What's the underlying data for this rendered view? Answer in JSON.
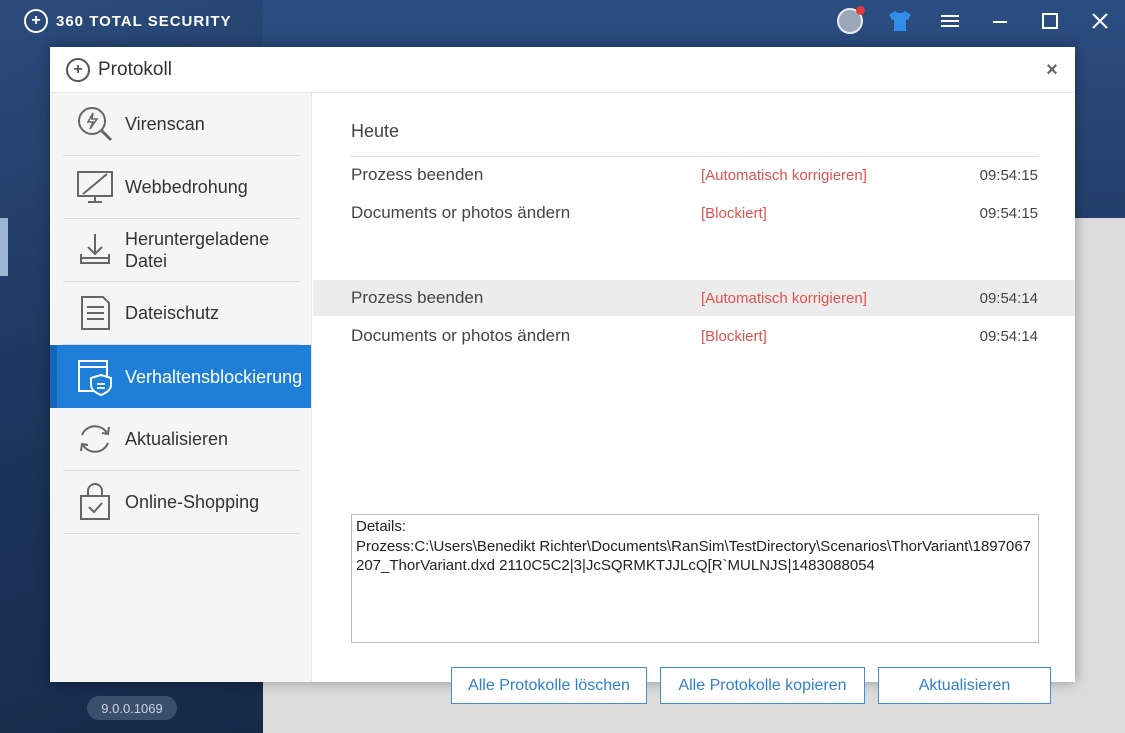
{
  "app": {
    "brand": "360 TOTAL SECURITY",
    "version": "9.0.0.1069"
  },
  "titlebar": {
    "icons": [
      "avatar-icon",
      "skin-shirt-icon",
      "menu-icon",
      "minimize-icon",
      "maximize-icon",
      "close-icon"
    ]
  },
  "dialog": {
    "title": "Protokoll",
    "close_symbol": "×",
    "nav": [
      {
        "label": "Virenscan",
        "icon": "virus-scan-icon",
        "active": false
      },
      {
        "label": "Webbedrohung",
        "icon": "web-threat-icon",
        "active": false
      },
      {
        "label": "Heruntergeladene Datei",
        "icon": "download-icon",
        "active": false
      },
      {
        "label": "Dateischutz",
        "icon": "file-protection-icon",
        "active": false
      },
      {
        "label": "Verhaltensblockierung",
        "icon": "behavior-block-icon",
        "active": true
      },
      {
        "label": "Aktualisieren",
        "icon": "update-icon",
        "active": false
      },
      {
        "label": "Online-Shopping",
        "icon": "shopping-bag-icon",
        "active": false
      }
    ],
    "section_title": "Heute",
    "logs": [
      {
        "name": "Prozess beenden",
        "status": "[Automatisch korrigieren]",
        "time": "09:54:15",
        "highlighted": false
      },
      {
        "name": "Documents or photos ändern",
        "status": "[Blockiert]",
        "time": "09:54:15",
        "highlighted": false
      },
      {
        "name": "Prozess beenden",
        "status": "[Automatisch korrigieren]",
        "time": "09:54:14",
        "highlighted": true
      },
      {
        "name": "Documents or photos ändern",
        "status": "[Blockiert]",
        "time": "09:54:14",
        "highlighted": false
      }
    ],
    "details_label": "Details:",
    "details_text": "Prozess:C:\\Users\\Benedikt Richter\\Documents\\RanSim\\TestDirectory\\Scenarios\\ThorVariant\\1897067207_ThorVariant.dxd 2110C5C2|3|JcSQRMKTJJLcQ[R`MULNJS|1483088054",
    "buttons": {
      "clear_all": "Alle Protokolle löschen",
      "copy_all": "Alle Protokolle kopieren",
      "refresh": "Aktualisieren"
    }
  },
  "colors": {
    "accent": "#1f7fd8",
    "status_red": "#e0524f",
    "app_navy": "#203a63"
  }
}
